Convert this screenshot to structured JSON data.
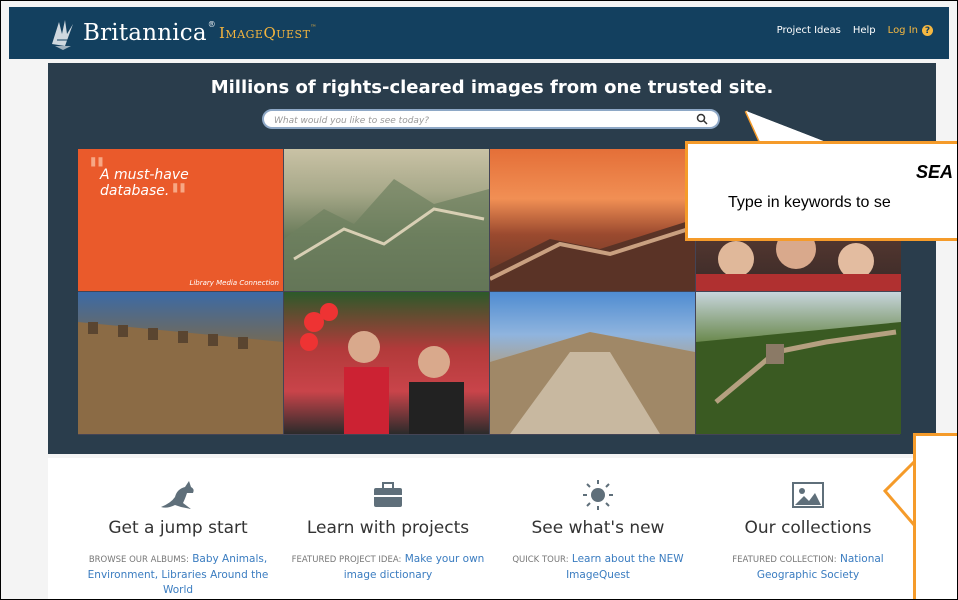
{
  "header": {
    "brand": "Britannica",
    "brand_mark": "®",
    "product": "ImageQuest",
    "product_mark": "™",
    "nav": {
      "project_ideas": "Project Ideas",
      "help": "Help",
      "login": "Log In"
    }
  },
  "hero": {
    "tagline": "Millions of rights-cleared images from one trusted site.",
    "search_placeholder": "What would you like to see today?",
    "quote": {
      "text_line1": "A must-have",
      "text_line2": "database.",
      "source": "Library Media Connection"
    }
  },
  "callouts": {
    "search": {
      "title": "SEA",
      "body": "Type in keywords to se"
    }
  },
  "features": [
    {
      "icon": "kangaroo-icon",
      "title": "Get a jump start",
      "label": "Browse our albums:",
      "link": "Baby Animals, Environment, Libraries Around the World"
    },
    {
      "icon": "briefcase-icon",
      "title": "Learn with projects",
      "label": "Featured project idea:",
      "link": "Make your own image dictionary"
    },
    {
      "icon": "sun-icon",
      "title": "See what's new",
      "label": "Quick tour:",
      "link": "Learn about the NEW ImageQuest"
    },
    {
      "icon": "picture-icon",
      "title": "Our collections",
      "label": "Featured collection:",
      "link": "National Geographic Society"
    }
  ],
  "colors": {
    "header_bg": "#13405f",
    "hero_bg": "#2a3d4c",
    "accent_orange": "#ea5a2b",
    "callout_border": "#f59b2a",
    "link_blue": "#3a7cc0"
  }
}
